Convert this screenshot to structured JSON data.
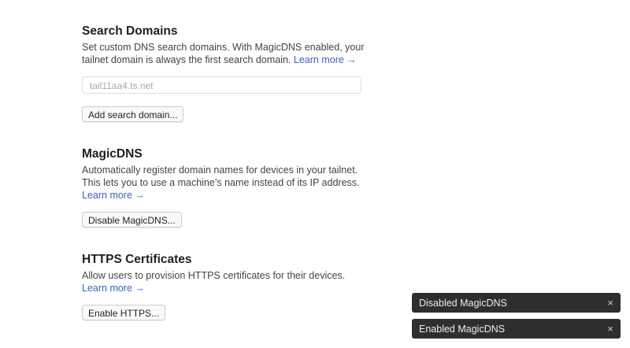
{
  "search": {
    "title": "Search Domains",
    "desc": "Set custom DNS search domains. With MagicDNS enabled, your tailnet domain is always the first search domain.",
    "link": "Learn more →",
    "placeholder": "tail11aa4.ts.net",
    "button": "Add search domain..."
  },
  "magic": {
    "title": "MagicDNS",
    "desc": "Automatically register domain names for devices in your tailnet. This lets you to use a machine’s name instead of its IP address.",
    "link": "Learn more →",
    "button": "Disable MagicDNS..."
  },
  "https": {
    "title": "HTTPS Certificates",
    "desc": "Allow users to provision HTTPS certificates for their devices.",
    "link": "Learn more →",
    "button": "Enable HTTPS..."
  },
  "toasts": [
    {
      "text": "Disabled MagicDNS",
      "close": "×"
    },
    {
      "text": "Enabled MagicDNS",
      "close": "×"
    }
  ]
}
